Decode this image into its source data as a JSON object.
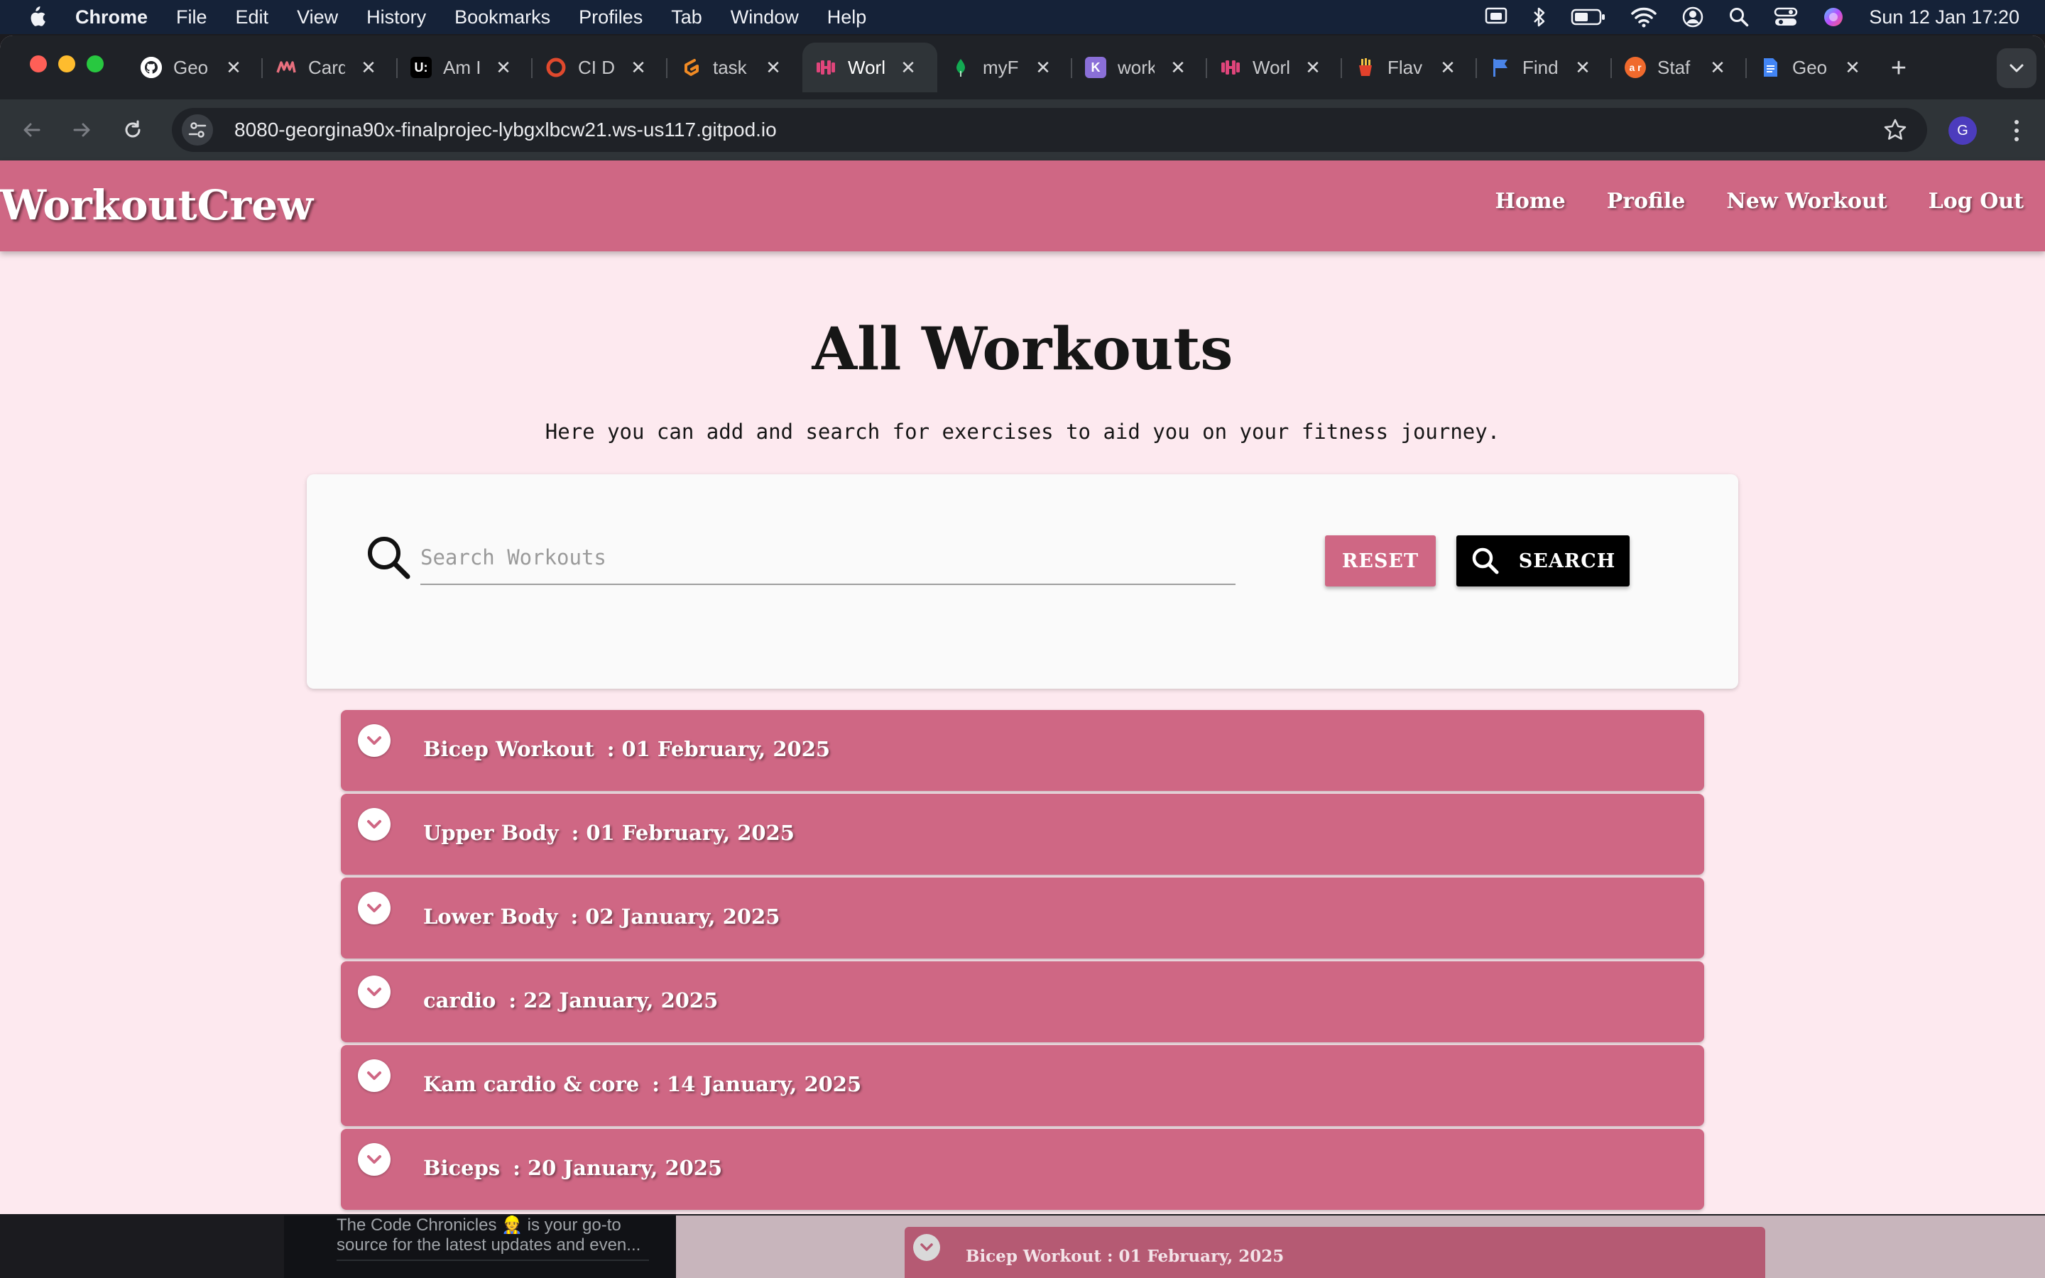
{
  "menubar": {
    "app": "Chrome",
    "items": [
      "File",
      "Edit",
      "View",
      "History",
      "Bookmarks",
      "Profiles",
      "Tab",
      "Window",
      "Help"
    ],
    "clock": "Sun 12 Jan  17:20"
  },
  "browser": {
    "tabs": [
      {
        "title": "Geo",
        "favicon": "github-icon",
        "color": "#ffffff",
        "glyph": ""
      },
      {
        "title": "Card",
        "favicon": "card-icon",
        "color": "#e8707e",
        "glyph": ""
      },
      {
        "title": "Am I",
        "favicon": "amiresponsive-icon",
        "color": "#000000",
        "glyph": "U:"
      },
      {
        "title": "CI D",
        "favicon": "ci-icon",
        "color": "#e0492d",
        "glyph": ""
      },
      {
        "title": "task",
        "favicon": "gitpod-icon",
        "color": "#f08a24",
        "glyph": ""
      },
      {
        "title": "Worl",
        "favicon": "dumbbell-icon",
        "color": "#e0457b",
        "glyph": ""
      },
      {
        "title": "myF",
        "favicon": "mongodb-leaf-icon",
        "color": "#13aa52",
        "glyph": ""
      },
      {
        "title": "work",
        "favicon": "heroku-icon",
        "color": "#8a6fd8",
        "glyph": "K"
      },
      {
        "title": "Worl",
        "favicon": "dumbbell-icon",
        "color": "#e0457b",
        "glyph": ""
      },
      {
        "title": "Flav",
        "favicon": "fries-icon",
        "color": "#e2412c",
        "glyph": ""
      },
      {
        "title": "Find",
        "favicon": "flag-icon",
        "color": "#4a84e8",
        "glyph": ""
      },
      {
        "title": "Staf",
        "favicon": "ar-icon",
        "color": "#f06a2d",
        "glyph": "a r"
      },
      {
        "title": "Geo",
        "favicon": "google-docs-icon",
        "color": "#4285f4",
        "glyph": ""
      }
    ],
    "active_tab": 5,
    "url": "8080-georgina90x-finalprojec-lybgxlbcw21.ws-us117.gitpod.io",
    "profile_initial": "G"
  },
  "site": {
    "brand": "WorkoutCrew",
    "nav": {
      "home": "Home",
      "profile": "Profile",
      "new_workout": "New Workout",
      "logout": "Log Out"
    },
    "title": "All Workouts",
    "subtitle": "Here you can add and search for exercises to aid you on your fitness journey.",
    "search": {
      "placeholder": "Search Workouts",
      "value": "",
      "reset_label": "RESET",
      "search_label": "SEARCH"
    },
    "workouts": [
      {
        "name": "Bicep Workout",
        "date": "01 February, 2025"
      },
      {
        "name": "Upper Body",
        "date": "01 February, 2025"
      },
      {
        "name": "Lower Body",
        "date": "02 January, 2025"
      },
      {
        "name": "cardio",
        "date": "22 January, 2025"
      },
      {
        "name": "Kam cardio & core",
        "date": "14 January, 2025"
      },
      {
        "name": "Biceps",
        "date": "20 January, 2025"
      }
    ],
    "colors": {
      "primary": "#cf6784",
      "background": "#fde9ef",
      "search_button": "#000000"
    }
  },
  "background_windows": {
    "left_text": "The Code Chronicles 👷 is your go-to source for the latest updates and even...",
    "right_text": "Bicep Workout  : 01 February, 2025"
  }
}
